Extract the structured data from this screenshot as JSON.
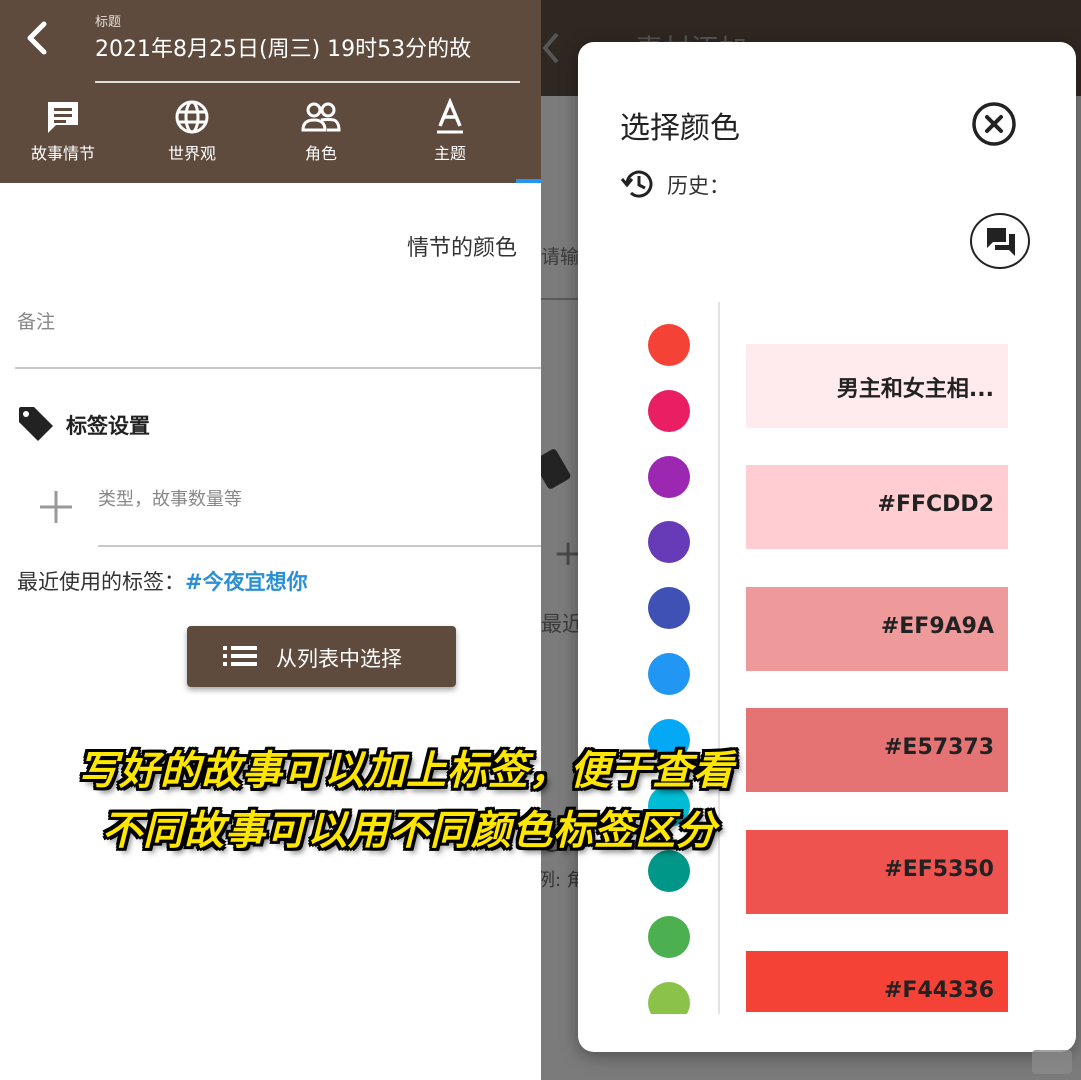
{
  "header": {
    "title_label": "标题",
    "title_value": "2021年8月25日(周三) 19时53分的故",
    "tabs": [
      {
        "label": "故事情节",
        "icon": "message-icon"
      },
      {
        "label": "世界观",
        "icon": "globe-icon"
      },
      {
        "label": "角色",
        "icon": "people-icon"
      },
      {
        "label": "主题",
        "icon": "font-icon"
      }
    ],
    "accent_color": "#5e4b3e",
    "indicator_color": "#2196f3"
  },
  "form": {
    "plot_color_label": "情节的颜色",
    "note_placeholder": "备注",
    "tag_settings_heading": "标签设置",
    "tag_input_placeholder": "类型，故事数量等",
    "recent_tags_label": "最近使用的标签：",
    "recent_tag": "#今夜宜想你",
    "select_from_list_label": "从列表中选择"
  },
  "background_page": {
    "title": "素材添加",
    "hint": "请输入",
    "recent": "最近",
    "example": "例: 角"
  },
  "color_dialog": {
    "title": "选择颜色",
    "history_label": "历史：",
    "palette_dots": [
      "#f44336",
      "#e91e63",
      "#9c27b0",
      "#673ab7",
      "#3f51b5",
      "#2196f3",
      "#03a9f4",
      "#00bcd4",
      "#009688",
      "#4caf50",
      "#8bc34a"
    ],
    "swatches": [
      {
        "label": "男主和女主相...",
        "color": "#ffebee"
      },
      {
        "label": "#FFCDD2",
        "color": "#ffcdd2"
      },
      {
        "label": "#EF9A9A",
        "color": "#ef9a9a"
      },
      {
        "label": "#E57373",
        "color": "#e57373"
      },
      {
        "label": "#EF5350",
        "color": "#ef5350"
      },
      {
        "label": "#F44336",
        "color": "#f44336"
      }
    ]
  },
  "caption": {
    "line1": "写好的故事可以加上标签，便于查看",
    "line2": "不同故事可以用不同颜色标签区分",
    "color": "#ffe600"
  }
}
